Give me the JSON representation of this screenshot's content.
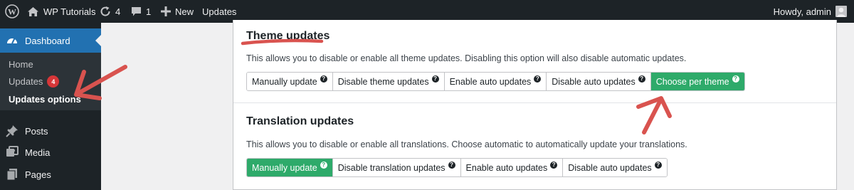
{
  "adminbar": {
    "site_name": "WP Tutorials",
    "updates_count": "4",
    "comments_count": "1",
    "new_label": "New",
    "updates_label": "Updates",
    "howdy": "Howdy, admin"
  },
  "sidebar": {
    "dashboard": "Dashboard",
    "submenu": {
      "home": "Home",
      "updates": "Updates",
      "updates_badge": "4",
      "updates_options": "Updates options"
    },
    "posts": "Posts",
    "media": "Media",
    "pages": "Pages"
  },
  "theme": {
    "title": "Theme updates",
    "description": "This allows you to disable or enable all theme updates. Disabling this option will also disable automatic updates.",
    "options": [
      "Manually update",
      "Disable theme updates",
      "Enable auto updates",
      "Disable auto updates",
      "Choose per theme"
    ],
    "selected": "Choose per theme",
    "help_glyph": "?"
  },
  "translation": {
    "title": "Translation updates",
    "description": "This allows you to disable or enable all translations. Choose automatic to automatically update your translations.",
    "options": [
      "Manually update",
      "Disable translation updates",
      "Enable auto updates",
      "Disable auto updates"
    ],
    "selected": "Manually update",
    "help_glyph": "?"
  },
  "colors": {
    "admin_bar": "#1d2327",
    "active_menu": "#2271b1",
    "selected_option": "#2eaa6a",
    "annotation": "#d9534f",
    "badge": "#d63638"
  },
  "icons": [
    "wordpress-logo-icon",
    "home-icon",
    "refresh-icon",
    "comment-icon",
    "plus-icon",
    "avatar-icon",
    "dashboard-icon",
    "pin-icon",
    "media-icon",
    "pages-icon",
    "help-icon"
  ]
}
